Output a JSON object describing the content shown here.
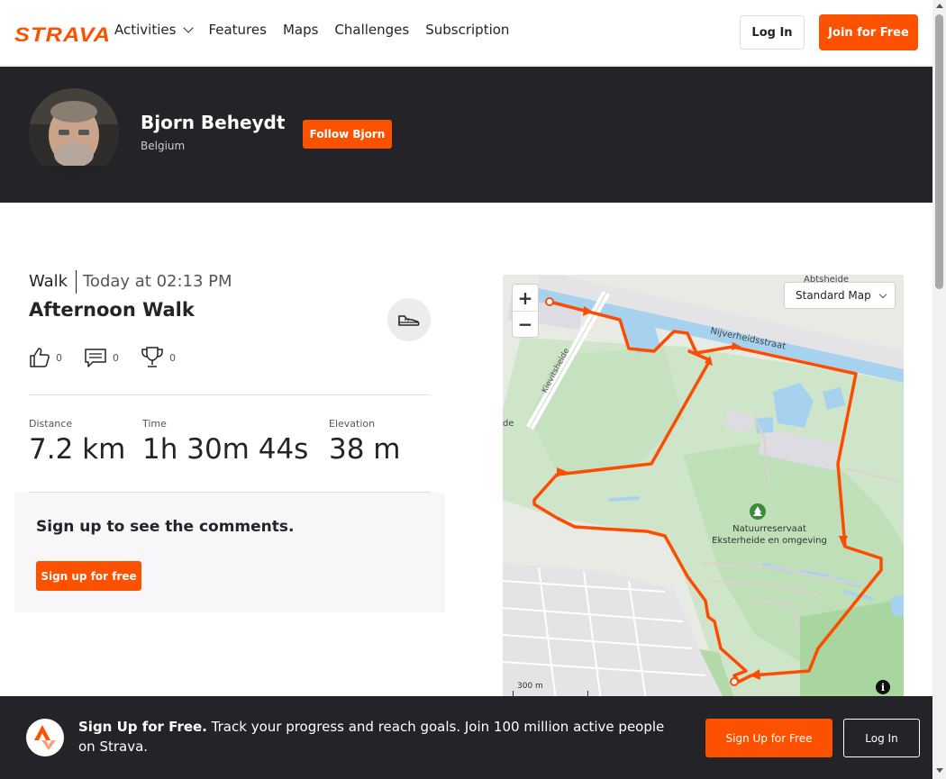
{
  "nav": {
    "logo": "STRAVA",
    "links": [
      "Activities",
      "Features",
      "Maps",
      "Challenges",
      "Subscription"
    ],
    "login_label": "Log In",
    "join_label": "Join for Free"
  },
  "athlete": {
    "name": "Bjorn Beheydt",
    "location": "Belgium",
    "follow_label": "Follow Bjorn"
  },
  "activity": {
    "type": "Walk",
    "date": "Today at 02:13 PM",
    "title": "Afternoon Walk",
    "kudos": "0",
    "comments": "0",
    "achievements": "0",
    "stats": [
      {
        "label": "Distance",
        "value": "7.2 km"
      },
      {
        "label": "Time",
        "value": "1h 30m 44s"
      },
      {
        "label": "Elevation",
        "value": "38 m"
      }
    ]
  },
  "comments_signup": {
    "title": "Sign up to see the comments.",
    "button": "Sign up for free"
  },
  "map": {
    "map_type": "Standard Map",
    "zoom_in": "+",
    "zoom_out": "−",
    "scale": "300 m",
    "labels": {
      "street1": "Nijverheidsstraat",
      "street2": "Kievitsheide",
      "place1": "Abtsheide",
      "park_line1": "Natuurreservaat",
      "park_line2": "Eksterheide en omgeving",
      "edge": "de"
    },
    "route_color": "#fc4c02"
  },
  "bottom_bar": {
    "headline": "Sign Up for Free.",
    "text": " Track your progress and reach goals. Join 100 million active people on Strava.",
    "signup_label": "Sign Up for Free",
    "login_label": "Log In"
  },
  "colors": {
    "brand": "#fc5200",
    "dark": "#242428"
  }
}
